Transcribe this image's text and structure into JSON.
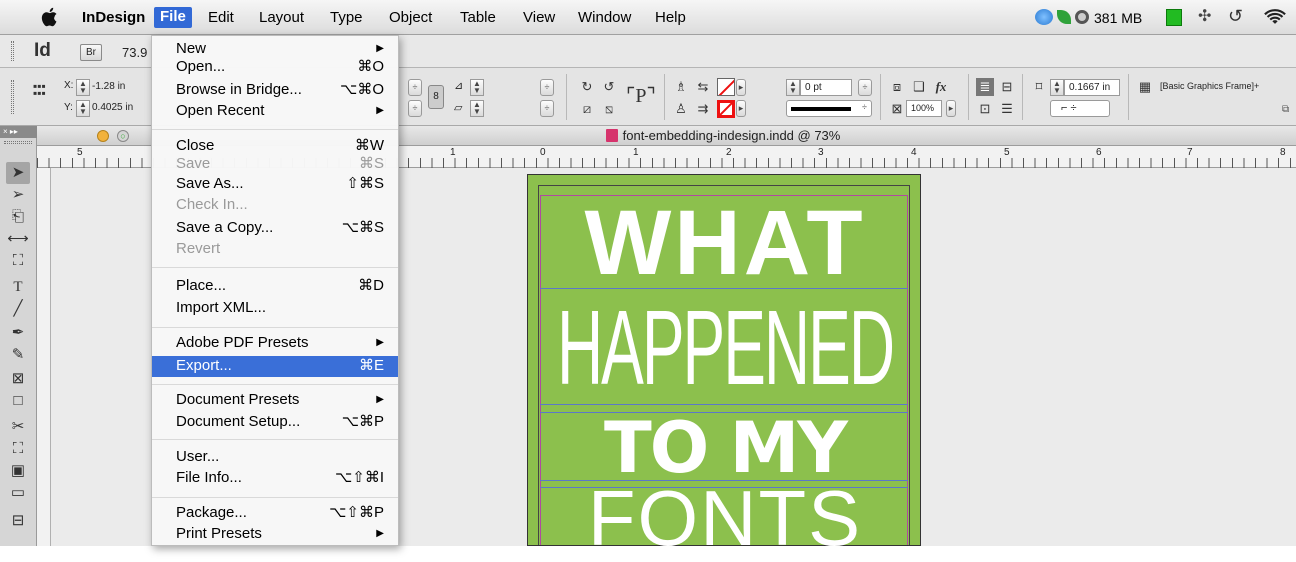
{
  "menubar": {
    "app_name": "InDesign",
    "items": [
      "File",
      "Edit",
      "Layout",
      "Type",
      "Object",
      "Table",
      "View",
      "Window",
      "Help"
    ],
    "memory": "381 MB"
  },
  "appbar": {
    "logo": "Id",
    "bridge": "Br",
    "zoom": "73.9"
  },
  "control": {
    "x_label": "X:",
    "x_value": "-1.28 in",
    "y_label": "Y:",
    "y_value": "0.4025 in",
    "stroke_weight": "0 pt",
    "opacity": "100%",
    "width_value": "0.1667 in",
    "object_style": "[Basic Graphics Frame]+"
  },
  "document": {
    "title": "font-embedding-indesign.indd @ 73%"
  },
  "ruler": {
    "labels": [
      "5",
      "1",
      "0",
      "1",
      "2",
      "3",
      "4",
      "5",
      "6",
      "7",
      "8"
    ]
  },
  "poster": {
    "line1": "WHAT",
    "line2": "HAPPENED",
    "line3": "TO MY",
    "line4": "FONTS",
    "bg_color": "#8cc04d"
  },
  "file_menu": {
    "title": "File",
    "groups": [
      [
        {
          "label": "New",
          "shortcut": "▶",
          "enabled": true
        },
        {
          "label": "Open...",
          "shortcut": "⌘O",
          "enabled": true
        },
        {
          "label": "Browse in Bridge...",
          "shortcut": "⌥⌘O",
          "enabled": true
        },
        {
          "label": "Open Recent",
          "shortcut": "▶",
          "enabled": true
        }
      ],
      [
        {
          "label": "Close",
          "shortcut": "⌘W",
          "enabled": true
        },
        {
          "label": "Save",
          "shortcut": "⌘S",
          "enabled": false
        },
        {
          "label": "Save As...",
          "shortcut": "⇧⌘S",
          "enabled": true
        },
        {
          "label": "Check In...",
          "shortcut": "",
          "enabled": false
        },
        {
          "label": "Save a Copy...",
          "shortcut": "⌥⌘S",
          "enabled": true
        },
        {
          "label": "Revert",
          "shortcut": "",
          "enabled": false
        }
      ],
      [
        {
          "label": "Place...",
          "shortcut": "⌘D",
          "enabled": true
        },
        {
          "label": "Import XML...",
          "shortcut": "",
          "enabled": true
        }
      ],
      [
        {
          "label": "Adobe PDF Presets",
          "shortcut": "▶",
          "enabled": true
        },
        {
          "label": "Export...",
          "shortcut": "⌘E",
          "enabled": true,
          "selected": true
        }
      ],
      [
        {
          "label": "Document Presets",
          "shortcut": "▶",
          "enabled": true
        },
        {
          "label": "Document Setup...",
          "shortcut": "⌥⌘P",
          "enabled": true
        }
      ],
      [
        {
          "label": "User...",
          "shortcut": "",
          "enabled": true
        },
        {
          "label": "File Info...",
          "shortcut": "⌥⇧⌘I",
          "enabled": true
        }
      ],
      [
        {
          "label": "Package...",
          "shortcut": "⌥⇧⌘P",
          "enabled": true
        },
        {
          "label": "Print Presets",
          "shortcut": "▶",
          "enabled": true
        }
      ]
    ]
  },
  "colors": {
    "menu_highlight": "#3a6fd8",
    "poster_green": "#8cc04d"
  }
}
